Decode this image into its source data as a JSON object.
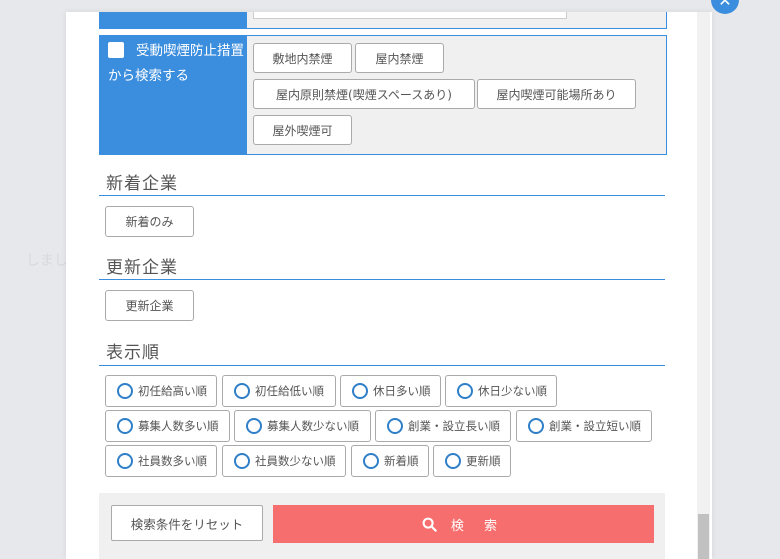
{
  "background": {
    "hint_text": "しました"
  },
  "close_button": {
    "glyph": "✕"
  },
  "smoking": {
    "label": "受動喫煙防止措置から検索する",
    "options": [
      "敷地内禁煙",
      "屋内禁煙",
      "屋内原則禁煙(喫煙スペースあり)",
      "屋内喫煙可能場所あり",
      "屋外喫煙可"
    ]
  },
  "new_company": {
    "title": "新着企業",
    "button": "新着のみ"
  },
  "updated_company": {
    "title": "更新企業",
    "button": "更新企業"
  },
  "sort": {
    "title": "表示順",
    "options": [
      "初任給高い順",
      "初任給低い順",
      "休日多い順",
      "休日少ない順",
      "募集人数多い順",
      "募集人数少ない順",
      "創業・設立長い順",
      "創業・設立短い順",
      "社員数多い順",
      "社員数少ない順",
      "新着順",
      "更新順"
    ]
  },
  "footer": {
    "reset_label": "検索条件をリセット",
    "search_label": "検 索"
  },
  "colors": {
    "accent": "#3b8ddd",
    "search": "#f76e6e",
    "panel": "#f0f0f0"
  }
}
